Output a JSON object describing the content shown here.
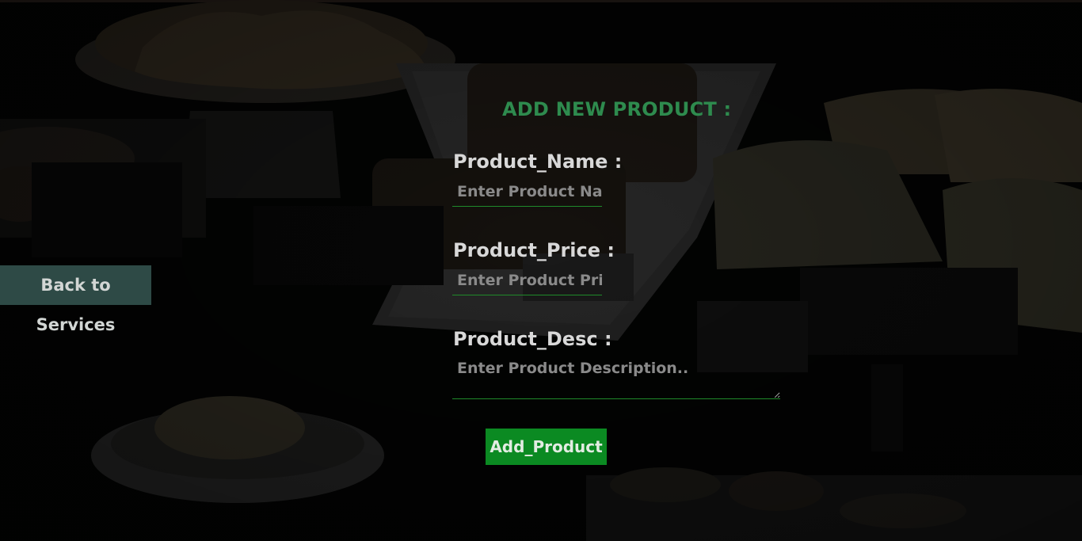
{
  "page": {
    "back_button_label": "Back to Services"
  },
  "form": {
    "title": "ADD NEW PRODUCT :",
    "fields": [
      {
        "label": "Product_Name :",
        "placeholder": "Enter Product Name",
        "value": ""
      },
      {
        "label": "Product_Price :",
        "placeholder": "Enter Product Price",
        "value": ""
      },
      {
        "label": "Product_Desc :",
        "placeholder": "Enter Product Description..",
        "value": ""
      }
    ],
    "submit_label": "Add_Product"
  },
  "colors": {
    "title": "#2e8b4e",
    "submit_background": "#0b8a22",
    "back_button_background": "#2e4a46",
    "input_underline": "#1f8a2a"
  }
}
